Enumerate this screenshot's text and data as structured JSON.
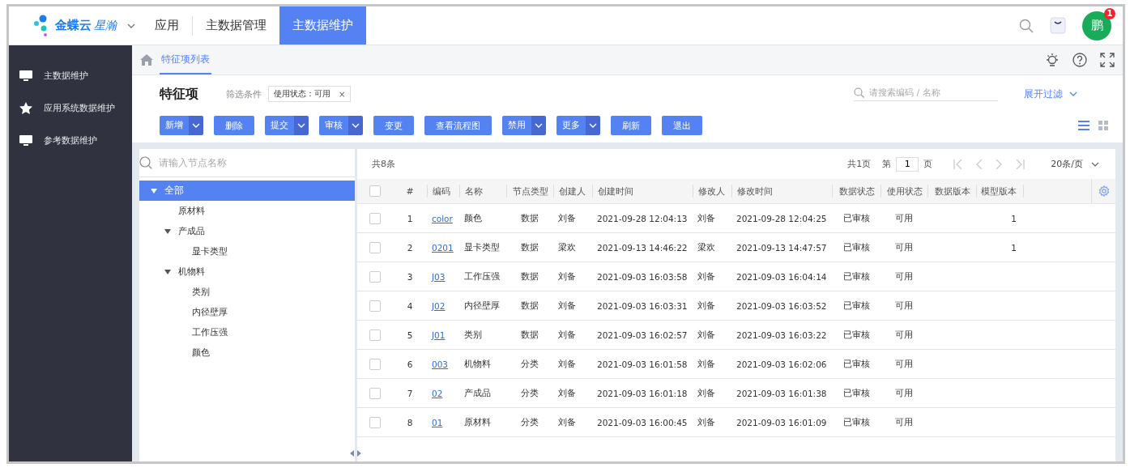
{
  "header": {
    "logo": {
      "brand": "金蝶云",
      "product": "星瀚"
    },
    "nav": [
      {
        "label": "应用",
        "selected": false
      },
      {
        "label": "主数据管理",
        "selected": false
      },
      {
        "label": "主数据维护",
        "selected": true
      }
    ],
    "avatar": {
      "initial": "鹏",
      "badge": "1"
    }
  },
  "sidebar": {
    "items": [
      {
        "label": "主数据维护",
        "kind": "screen"
      },
      {
        "label": "应用系统数据维护",
        "kind": "favorite"
      },
      {
        "label": "参考数据维护",
        "kind": "screen"
      }
    ]
  },
  "breadcrumb": {
    "tabs": [
      {
        "label": "特征项列表",
        "selected": true
      }
    ]
  },
  "page": {
    "title": "特征项",
    "filter_label": "筛选条件",
    "filter_tag": {
      "label": "使用状态：可用",
      "remove": "×"
    },
    "search": {
      "placeholder": "请搜索编码 / 名称"
    },
    "expand_filter": "展开过滤"
  },
  "toolbar": [
    {
      "label": "新增",
      "dropdown": true
    },
    {
      "label": "删除",
      "dropdown": false
    },
    {
      "label": "提交",
      "dropdown": true
    },
    {
      "label": "审核",
      "dropdown": true
    },
    {
      "label": "变更",
      "dropdown": false
    },
    {
      "label": "查看流程图",
      "dropdown": false
    },
    {
      "label": "禁用",
      "dropdown": true
    },
    {
      "label": "更多",
      "dropdown": true
    },
    {
      "label": "刷新",
      "dropdown": false
    },
    {
      "label": "退出",
      "dropdown": false
    }
  ],
  "view_modes": [
    {
      "kind": "list",
      "selected": true
    },
    {
      "kind": "grid",
      "selected": false
    }
  ],
  "tree": {
    "search": {
      "placeholder": "请输入节点名称"
    },
    "nodes": [
      {
        "label": "全部",
        "selected": true,
        "expanded": true,
        "children": [
          {
            "label": "原材料",
            "selected": false
          },
          {
            "label": "产成品",
            "selected": false,
            "expanded": true,
            "children": [
              {
                "label": "显卡类型",
                "selected": false
              }
            ]
          },
          {
            "label": "机物料",
            "selected": false,
            "expanded": true,
            "children": [
              {
                "label": "类别",
                "selected": false
              },
              {
                "label": "内径壁厚",
                "selected": false
              },
              {
                "label": "工作压强",
                "selected": false
              },
              {
                "label": "颜色",
                "selected": false
              }
            ]
          }
        ]
      }
    ]
  },
  "table": {
    "total": "共8条",
    "pager": {
      "pages": "共1页",
      "page_prefix": "第",
      "page": "1",
      "page_suffix": "页",
      "page_size": "20条/页"
    },
    "select_all": {
      "checked": false
    },
    "columns": [
      {
        "label": "#"
      },
      {
        "label": "编码",
        "kind": "link"
      },
      {
        "label": "名称"
      },
      {
        "label": "节点类型"
      },
      {
        "label": "创建人"
      },
      {
        "label": "创建时间"
      },
      {
        "label": "修改人"
      },
      {
        "label": "修改时间"
      },
      {
        "label": "数据状态"
      },
      {
        "label": "使用状态"
      },
      {
        "label": "数据版本"
      },
      {
        "label": "模型版本"
      }
    ],
    "rows": [
      {
        "checked": false,
        "cells": [
          "1",
          "color",
          "颜色",
          "数据",
          "刘备",
          "2021-09-28 12:04:13",
          "刘备",
          "2021-09-28 12:04:25",
          "已审核",
          "可用",
          null,
          "1"
        ]
      },
      {
        "checked": false,
        "cells": [
          "2",
          "0201",
          "显卡类型",
          "数据",
          "梁欢",
          "2021-09-13 14:46:22",
          "梁欢",
          "2021-09-13 14:47:57",
          "已审核",
          "可用",
          null,
          "1"
        ]
      },
      {
        "checked": false,
        "cells": [
          "3",
          "J03",
          "工作压强",
          "数据",
          "刘备",
          "2021-09-03 16:03:58",
          "刘备",
          "2021-09-03 16:04:14",
          "已审核",
          "可用",
          null,
          null
        ]
      },
      {
        "checked": false,
        "cells": [
          "4",
          "J02",
          "内径壁厚",
          "数据",
          "刘备",
          "2021-09-03 16:03:31",
          "刘备",
          "2021-09-03 16:03:52",
          "已审核",
          "可用",
          null,
          null
        ]
      },
      {
        "checked": false,
        "cells": [
          "5",
          "J01",
          "类别",
          "数据",
          "刘备",
          "2021-09-03 16:02:57",
          "刘备",
          "2021-09-03 16:03:22",
          "已审核",
          "可用",
          null,
          null
        ]
      },
      {
        "checked": false,
        "cells": [
          "6",
          "003",
          "机物料",
          "分类",
          "刘备",
          "2021-09-03 16:01:58",
          "刘备",
          "2021-09-03 16:02:06",
          "已审核",
          "可用",
          null,
          null
        ]
      },
      {
        "checked": false,
        "cells": [
          "7",
          "02",
          "产成品",
          "分类",
          "刘备",
          "2021-09-03 16:01:18",
          "刘备",
          "2021-09-03 16:01:38",
          "已审核",
          "可用",
          null,
          null
        ]
      },
      {
        "checked": false,
        "cells": [
          "8",
          "01",
          "原材料",
          "分类",
          "刘备",
          "2021-09-03 16:00:45",
          "刘备",
          "2021-09-03 16:01:09",
          "已审核",
          "可用",
          null,
          null
        ]
      }
    ]
  }
}
